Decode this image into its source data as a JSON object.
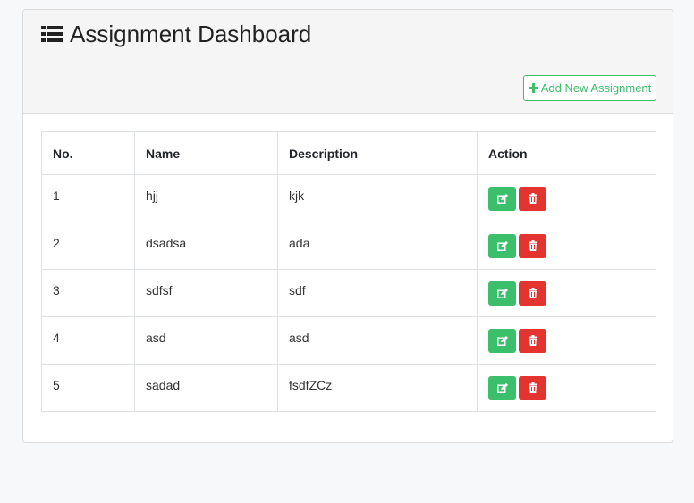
{
  "header": {
    "title": "Assignment Dashboard",
    "add_button_label": "Add New Assignment"
  },
  "table": {
    "columns": [
      "No.",
      "Name",
      "Description",
      "Action"
    ],
    "rows": [
      {
        "no": "1",
        "name": "hjj",
        "description": "kjk"
      },
      {
        "no": "2",
        "name": "dsadsa",
        "description": "ada"
      },
      {
        "no": "3",
        "name": "sdfsf",
        "description": "sdf"
      },
      {
        "no": "4",
        "name": "asd",
        "description": "asd"
      },
      {
        "no": "5",
        "name": "sadad",
        "description": "fsdfZCz"
      }
    ]
  },
  "icons": {
    "title_icon": "list-icon",
    "add_icon": "plus-icon",
    "edit_icon": "edit-icon",
    "delete_icon": "trash-icon"
  },
  "colors": {
    "success": "#3cbf6b",
    "danger": "#e3342f",
    "header_bg": "#f5f5f5"
  }
}
